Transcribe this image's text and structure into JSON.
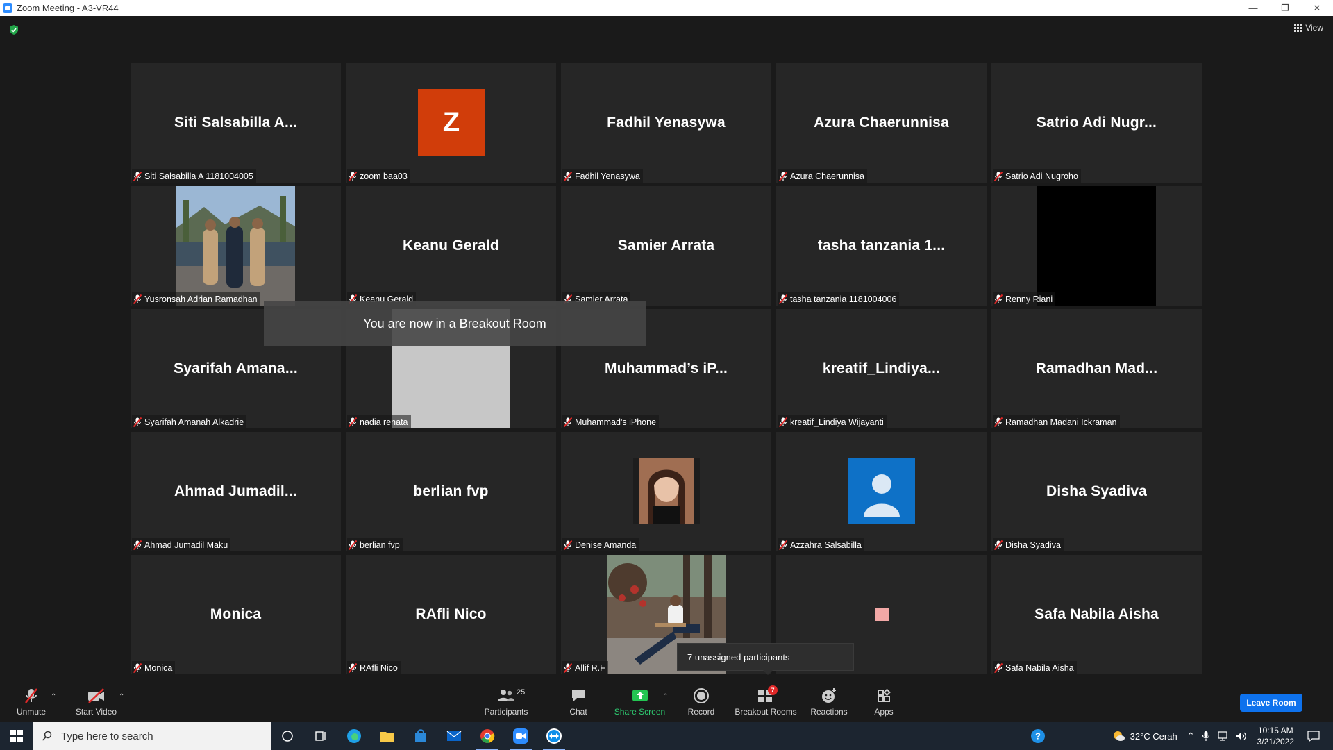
{
  "window": {
    "title": "Zoom Meeting - A3-VR44"
  },
  "view_label": "View",
  "tiles": [
    {
      "display": "Siti  Salsabilla  A...",
      "label": "Siti Salsabilla A 1181004005",
      "kind": "name"
    },
    {
      "display": "Z",
      "label": "zoom baa03",
      "kind": "letter"
    },
    {
      "display": "Fadhil Yenasywa",
      "label": "Fadhil Yenasywa",
      "kind": "name"
    },
    {
      "display": "Azura Chaerunnisa",
      "label": "Azura Chaerunnisa",
      "kind": "name"
    },
    {
      "display": "Satrio  Adi  Nugr...",
      "label": "Satrio Adi Nugroho",
      "kind": "name"
    },
    {
      "display": "",
      "label": "Yusronsah Adrian Ramadhan",
      "kind": "photo-group"
    },
    {
      "display": "Keanu Gerald",
      "label": "Keanu Gerald",
      "kind": "name"
    },
    {
      "display": "Samier Arrata",
      "label": "Samier Arrata",
      "kind": "name"
    },
    {
      "display": "tasha  tanzania  1...",
      "label": "tasha tanzania 1181004006",
      "kind": "name"
    },
    {
      "display": "",
      "label": "Renny Riani",
      "kind": "black-video"
    },
    {
      "display": "Syarifah  Amana...",
      "label": "Syarifah Amanah Alkadrie",
      "kind": "name"
    },
    {
      "display": "",
      "label": "nadia renata",
      "kind": "grey-video"
    },
    {
      "display": "Muhammad’s  iP...",
      "label": "Muhammad's iPhone",
      "kind": "name"
    },
    {
      "display": "kreatif_Lindiya...",
      "label": "kreatif_Lindiya Wijayanti",
      "kind": "name"
    },
    {
      "display": "Ramadhan  Mad...",
      "label": "Ramadhan Madani Ickraman",
      "kind": "name"
    },
    {
      "display": "Ahmad  Jumadil...",
      "label": "Ahmad Jumadil Maku",
      "kind": "name"
    },
    {
      "display": "berlian fvp",
      "label": "berlian fvp",
      "kind": "name"
    },
    {
      "display": "",
      "label": "Denise Amanda",
      "kind": "photo-small"
    },
    {
      "display": "",
      "label": "Azzahra Salsabilla",
      "kind": "default-avatar"
    },
    {
      "display": "Disha Syadiva",
      "label": "Disha Syadiva",
      "kind": "name"
    },
    {
      "display": "Monica",
      "label": "Monica",
      "kind": "name"
    },
    {
      "display": "RAfli Nico",
      "label": "RAfli Nico",
      "kind": "name"
    },
    {
      "display": "",
      "label": "Allif R.F",
      "kind": "photo-outdoor"
    },
    {
      "display": "",
      "label": "",
      "kind": "pink-square"
    },
    {
      "display": "Safa Nabila Aisha",
      "label": "Safa Nabila Aisha",
      "kind": "name"
    }
  ],
  "breakout_banner": "You are now in a Breakout Room",
  "unassigned_tip": "7 unassigned participants",
  "toolbar": {
    "unmute": "Unmute",
    "start_video": "Start Video",
    "participants": "Participants",
    "participants_count": "25",
    "chat": "Chat",
    "share_screen": "Share Screen",
    "record": "Record",
    "breakout_rooms": "Breakout Rooms",
    "breakout_badge": "7",
    "reactions": "Reactions",
    "apps": "Apps",
    "leave_room": "Leave Room"
  },
  "taskbar": {
    "search_placeholder": "Type here to search",
    "weather": "32°C  Cerah",
    "time": "10:15 AM",
    "date": "3/21/2022"
  },
  "colors": {
    "accent": "#0e72ed",
    "share_green": "#2ecc71",
    "muted_red": "#e02828",
    "avatar_orange": "#d13d0a",
    "avatar_blue": "#0e71c7"
  }
}
